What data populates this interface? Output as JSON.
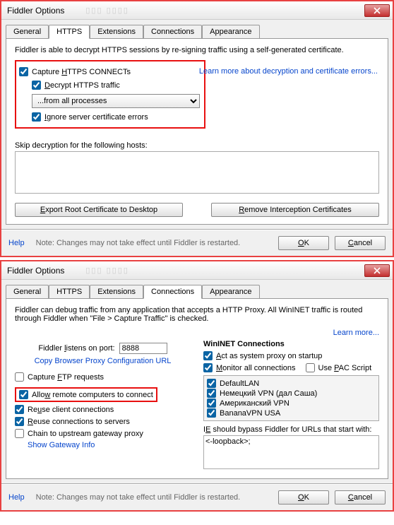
{
  "d1": {
    "title": "Fiddler Options",
    "tabs": [
      "General",
      "HTTPS",
      "Extensions",
      "Connections",
      "Appearance"
    ],
    "activeTab": "HTTPS",
    "desc": "Fiddler is able to decrypt HTTPS sessions by re-signing traffic using a self-generated certificate.",
    "capture": "Capture HTTPS CONNECTs",
    "decrypt": "Decrypt HTTPS traffic",
    "fromproc": "...from all processes",
    "ignore": "Ignore server certificate errors",
    "learn": "Learn more about decryption and certificate errors...",
    "skiplabel": "Skip decryption for the following hosts:",
    "skipval": "",
    "export": "Export Root Certificate to Desktop",
    "remove": "Remove Interception Certificates"
  },
  "d2": {
    "title": "Fiddler Options",
    "tabs": [
      "General",
      "HTTPS",
      "Extensions",
      "Connections",
      "Appearance"
    ],
    "activeTab": "Connections",
    "desc": "Fiddler can debug traffic from any application that accepts a HTTP Proxy. All WinINET traffic is routed through Fiddler when \"File > Capture Traffic\" is checked.",
    "learn": "Learn more...",
    "listenlabel": "Fiddler listens on port:",
    "port": "8888",
    "copyurl": "Copy Browser Proxy Configuration URL",
    "captureftp": "Capture FTP requests",
    "allowremote": "Allow remote computers to connect",
    "reuseclient": "Reuse client connections",
    "reuseserver": "Reuse connections to servers",
    "chain": "Chain to upstream gateway proxy",
    "gateway": "Show Gateway Info",
    "wininet": "WinINET Connections",
    "actsys": "Act as system proxy on startup",
    "monitor": "Monitor all connections",
    "usepac": "Use PAC Script",
    "conns": [
      "DefaultLAN",
      "Немецкий VPN (дал Саша)",
      "Американский VPN",
      "BananaVPN USA"
    ],
    "bypasslabel": "IE should bypass Fiddler for URLs that start with:",
    "bypassval": "<-loopback>;"
  },
  "common": {
    "help": "Help",
    "note": "Note: Changes may not take effect until Fiddler is restarted.",
    "ok": "OK",
    "cancel": "Cancel"
  }
}
